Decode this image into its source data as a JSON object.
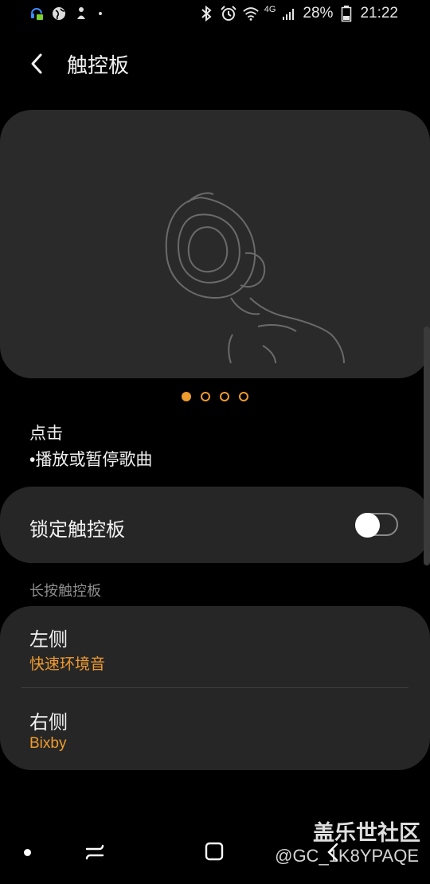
{
  "status_bar": {
    "network_label": "4G",
    "battery": "28%",
    "time": "21:22"
  },
  "header": {
    "title": "触控板"
  },
  "illustration": {
    "pages": 4,
    "active_page": 1
  },
  "tap": {
    "title": "点击",
    "description": "•播放或暂停歌曲"
  },
  "lock": {
    "label": "锁定触控板",
    "enabled": false
  },
  "long_press": {
    "section_title": "长按触控板",
    "left": {
      "label": "左侧",
      "value": "快速环境音"
    },
    "right": {
      "label": "右侧",
      "value": "Bixby"
    }
  },
  "watermark": {
    "site": "盖乐世社区",
    "user": "@GC_1K8YPAQE"
  },
  "colors": {
    "accent": "#ef9b2e",
    "card": "#262626",
    "background": "#000000"
  },
  "icons": [
    "headset-notification-icon",
    "globe-icon",
    "location-icon",
    "bluetooth-icon",
    "alarm-icon",
    "wifi-icon",
    "signal-icon",
    "battery-icon",
    "back-arrow-icon",
    "recents-icon",
    "home-icon",
    "nav-back-icon"
  ]
}
